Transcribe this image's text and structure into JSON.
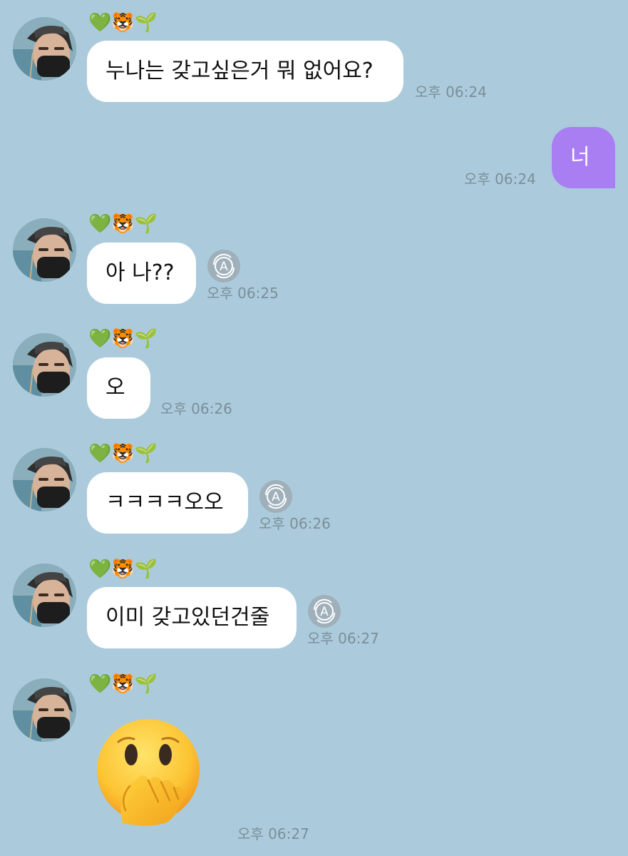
{
  "contact": {
    "name": "💚🐯🌱"
  },
  "messages": [
    {
      "id": "m1",
      "direction": "incoming",
      "text": "누나는 갖고싶은거 뭐 없어요?",
      "time": "오후 06:24"
    },
    {
      "id": "m2",
      "direction": "outgoing",
      "text": "너",
      "time": "오후 06:24"
    },
    {
      "id": "m3",
      "direction": "incoming",
      "text": "아 나??",
      "time": "오후 06:25"
    },
    {
      "id": "m4",
      "direction": "incoming",
      "text": "오",
      "time": "오후 06:26"
    },
    {
      "id": "m5",
      "direction": "incoming",
      "text": "ㅋㅋㅋㅋ오오",
      "time": "오후 06:26"
    },
    {
      "id": "m6",
      "direction": "incoming",
      "text": "이미 갖고있던건줄",
      "time": "오후 06:27"
    },
    {
      "id": "m7",
      "direction": "incoming",
      "emoji": "face-with-hand-over-mouth",
      "time": "오후 06:27"
    }
  ],
  "icons": {
    "translate": "translate-icon",
    "translate_letter": "A"
  },
  "colors": {
    "background": "#abcbdc",
    "incoming_bubble": "#ffffff",
    "outgoing_bubble": "#a97ef3",
    "timestamp": "#7b8e99"
  }
}
